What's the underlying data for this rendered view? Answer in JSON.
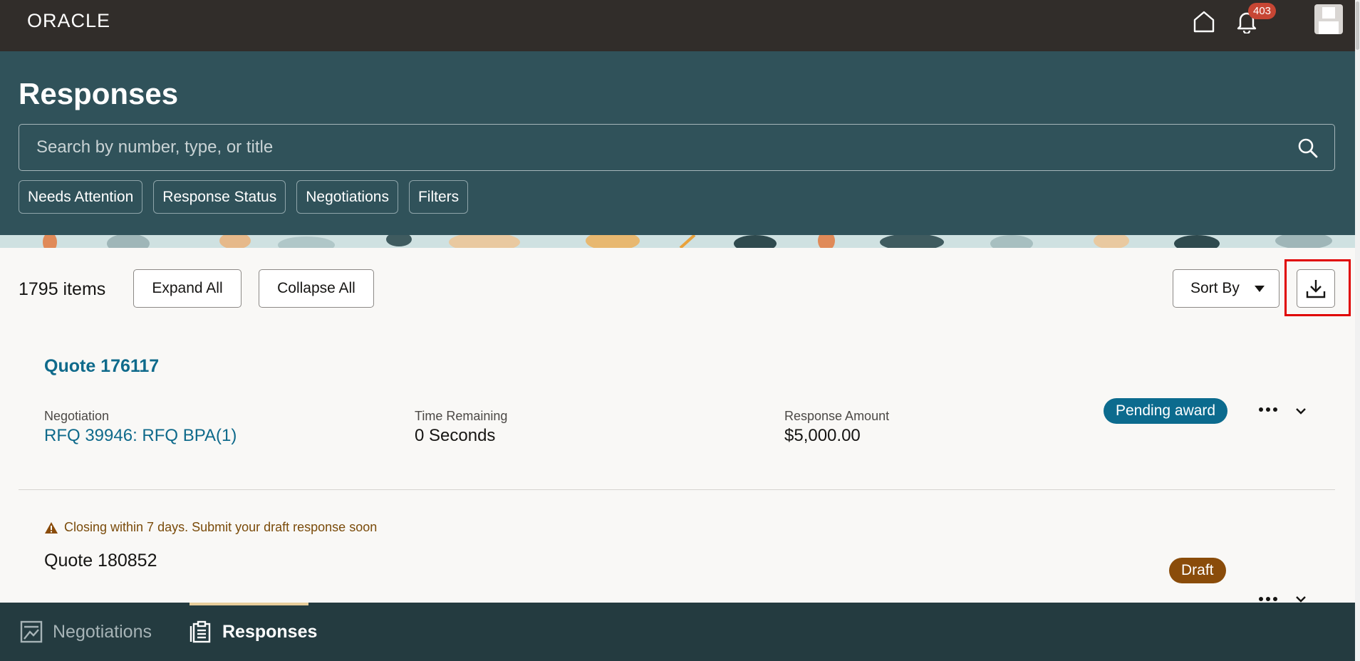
{
  "topbar": {
    "logo": "ORACLE",
    "notification_count": "403",
    "icons": {
      "home": "home-icon",
      "bell": "bell-icon",
      "avatar": "user-avatar"
    }
  },
  "header": {
    "title": "Responses",
    "search_placeholder": "Search by number, type, or title",
    "chips": [
      "Needs Attention",
      "Response Status",
      "Negotiations",
      "Filters"
    ]
  },
  "toolbar": {
    "item_count": "1795 items",
    "expand_label": "Expand All",
    "collapse_label": "Collapse All",
    "sort_label": "Sort By",
    "download_icon": "download-icon"
  },
  "responses": [
    {
      "title": "Quote 176117",
      "negotiation_label": "Negotiation",
      "negotiation_value": "RFQ 39946: RFQ BPA(1)",
      "time_label": "Time Remaining",
      "time_value": "0 Seconds",
      "amount_label": "Response Amount",
      "amount_value": "$5,000.00",
      "status": "Pending award",
      "status_color": "#0c6b8e"
    },
    {
      "warning": "Closing within 7 days. Submit your draft response soon",
      "title": "Quote 180852",
      "status": "Draft",
      "status_color": "#8a4c0a"
    }
  ],
  "bottom_nav": {
    "items": [
      {
        "label": "Negotiations",
        "icon": "negotiations-icon"
      },
      {
        "label": "Responses",
        "icon": "responses-icon",
        "active": true
      }
    ]
  },
  "colors": {
    "topbar": "#312d2a",
    "header": "#30525a",
    "link": "#0f6a8b",
    "bottom_nav": "#243b40",
    "highlight": "#e00000"
  }
}
